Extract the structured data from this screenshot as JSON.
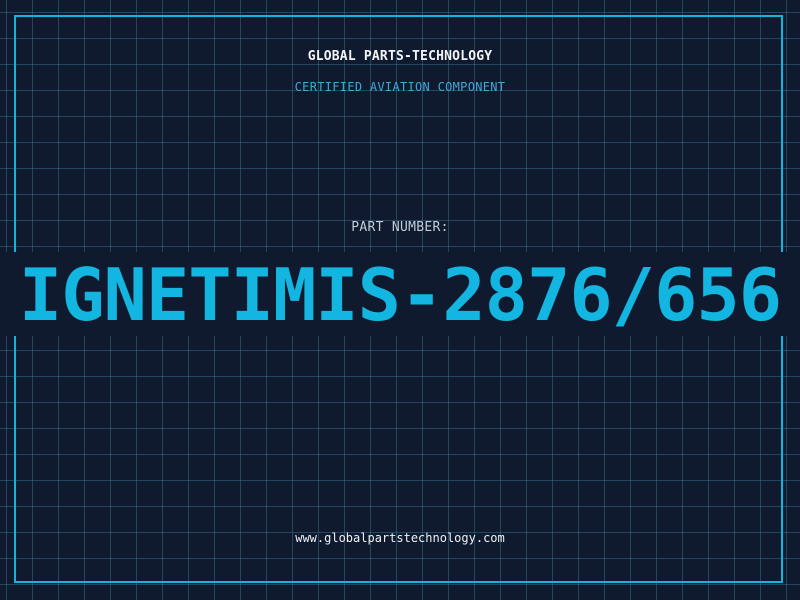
{
  "header": {
    "brand": "GLOBAL PARTS-TECHNOLOGY",
    "subtitle": "CERTIFIED AVIATION COMPONENT"
  },
  "part": {
    "label": "PART NUMBER:",
    "number": "IGNETIMIS-2876/656"
  },
  "footer": {
    "url": "www.globalpartstechnology.com"
  },
  "colors": {
    "background": "#101a2f",
    "grid": "#3c82a0",
    "accent": "#12b6e0",
    "frame": "#14b4dc"
  }
}
